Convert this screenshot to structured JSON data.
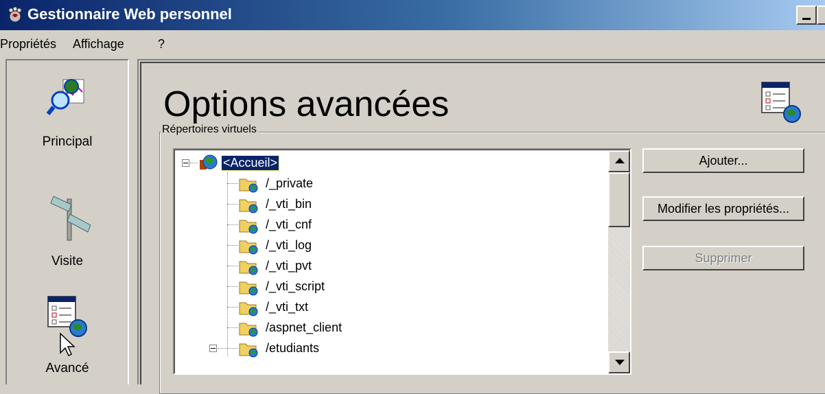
{
  "window": {
    "title": "Gestionnaire Web personnel"
  },
  "menu": {
    "items": [
      "Propriétés",
      "Affichage",
      "?"
    ]
  },
  "nav": {
    "items": [
      {
        "label": "Principal",
        "icon": "globe-magnifier-icon"
      },
      {
        "label": "Visite",
        "icon": "signpost-icon"
      },
      {
        "label": "Avancé",
        "icon": "advanced-options-icon"
      }
    ]
  },
  "main": {
    "title": "Options avancées",
    "group_label": "Répertoires virtuels",
    "tree": {
      "root": "<Accueil>",
      "children": [
        "/_private",
        "/_vti_bin",
        "/_vti_cnf",
        "/_vti_log",
        "/_vti_pvt",
        "/_vti_script",
        "/_vti_txt",
        "/aspnet_client",
        "/etudiants"
      ]
    },
    "buttons": {
      "add": "Ajouter...",
      "edit": "Modifier les propriétés...",
      "delete": "Supprimer"
    }
  },
  "colors": {
    "titlebar_start": "#0a246a",
    "titlebar_end": "#a6caf0",
    "face": "#d4d0c8",
    "selection": "#0a246a"
  }
}
